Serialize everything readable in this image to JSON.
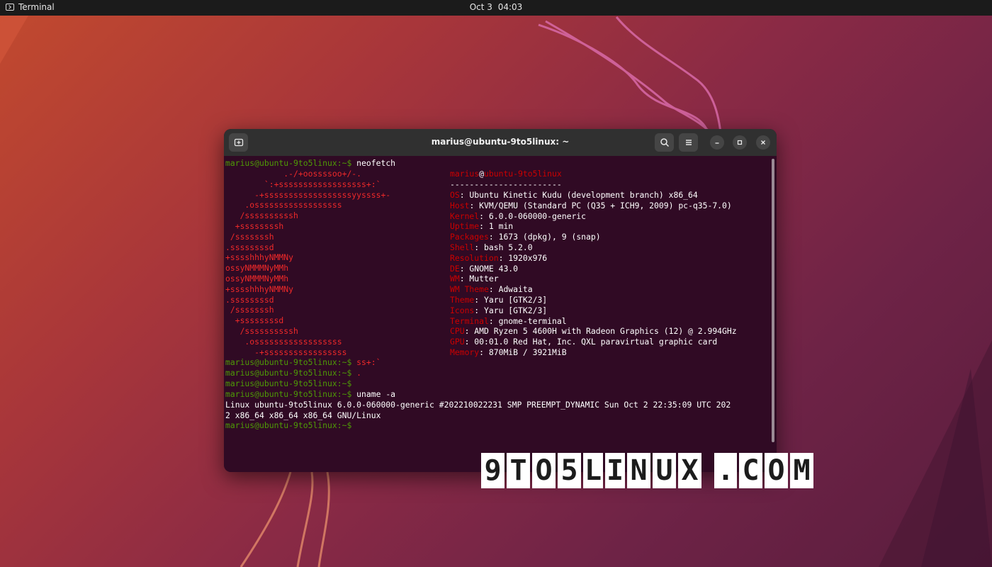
{
  "topbar": {
    "app_name": "Terminal",
    "date": "Oct 3",
    "time": "04:03"
  },
  "window": {
    "title": "marius@ubuntu-9to5linux: ~",
    "buttons": {
      "new_tab": "new-tab-icon",
      "search": "search-icon",
      "menu": "hamburger-menu-icon",
      "minimize": "minimize-icon",
      "maximize": "maximize-icon",
      "close": "close-icon"
    }
  },
  "terminal": {
    "prompt": "marius@ubuntu-9to5linux:~$",
    "cmd1": " neofetch",
    "art": [
      "            .-/+oossssoo+/-.",
      "        `:+ssssssssssssssssss+:`",
      "      -+ssssssssssssssssssyyssss+-",
      "    .ossssssssssssssssss",
      "   /ssssssssssh",
      "  +ssssssssh",
      " /sssssssh",
      ".ssssssssd",
      "+sssshhhyNMMNy",
      "ossyNMMMNyMMh",
      "ossyNMMMNyMMh",
      "+sssshhhyNMMNy",
      ".ssssssssd",
      " /sssssssh",
      "  +ssssssssd",
      "   /ssssssssssh",
      "    .ossssssssssssssssss",
      "      -+sssssssssssssssss"
    ],
    "neofetch": {
      "user": "marius",
      "at": "@",
      "host": "ubuntu-9to5linux",
      "sep": "-----------------------",
      "info": [
        {
          "k": "OS",
          "v": ": Ubuntu Kinetic Kudu (development branch) x86_64"
        },
        {
          "k": "Host",
          "v": ": KVM/QEMU (Standard PC (Q35 + ICH9, 2009) pc-q35-7.0)"
        },
        {
          "k": "Kernel",
          "v": ": 6.0.0-060000-generic"
        },
        {
          "k": "Uptime",
          "v": ": 1 min"
        },
        {
          "k": "Packages",
          "v": ": 1673 (dpkg), 9 (snap)"
        },
        {
          "k": "Shell",
          "v": ": bash 5.2.0"
        },
        {
          "k": "Resolution",
          "v": ": 1920x976"
        },
        {
          "k": "DE",
          "v": ": GNOME 43.0"
        },
        {
          "k": "WM",
          "v": ": Mutter"
        },
        {
          "k": "WM Theme",
          "v": ": Adwaita"
        },
        {
          "k": "Theme",
          "v": ": Yaru [GTK2/3]"
        },
        {
          "k": "Icons",
          "v": ": Yaru [GTK2/3]"
        },
        {
          "k": "Terminal",
          "v": ": gnome-terminal"
        },
        {
          "k": "CPU",
          "v": ": AMD Ryzen 5 4600H with Radeon Graphics (12) @ 2.994GHz"
        },
        {
          "k": "GPU",
          "v": ": 00:01.0 Red Hat, Inc. QXL paravirtual graphic card"
        },
        {
          "k": "Memory",
          "v": ": 870MiB / 3921MiB"
        }
      ]
    },
    "tail1": " ss+:`",
    "tail2": " .",
    "cmd2": " uname -a",
    "uname1": "Linux ubuntu-9to5linux 6.0.0-060000-generic #202210022231 SMP PREEMPT_DYNAMIC Sun Oct 2 22:35:09 UTC 202",
    "uname2": "2 x86_64 x86_64 x86_64 GNU/Linux"
  },
  "logo": {
    "letters": [
      "9",
      "T",
      "O",
      "5",
      "L",
      "I",
      "N",
      "U",
      "X",
      ".",
      "C",
      "O",
      "M"
    ]
  },
  "colors": {
    "prompt": "#4e9a06",
    "art": "#ef2929",
    "background": "#300a24"
  }
}
